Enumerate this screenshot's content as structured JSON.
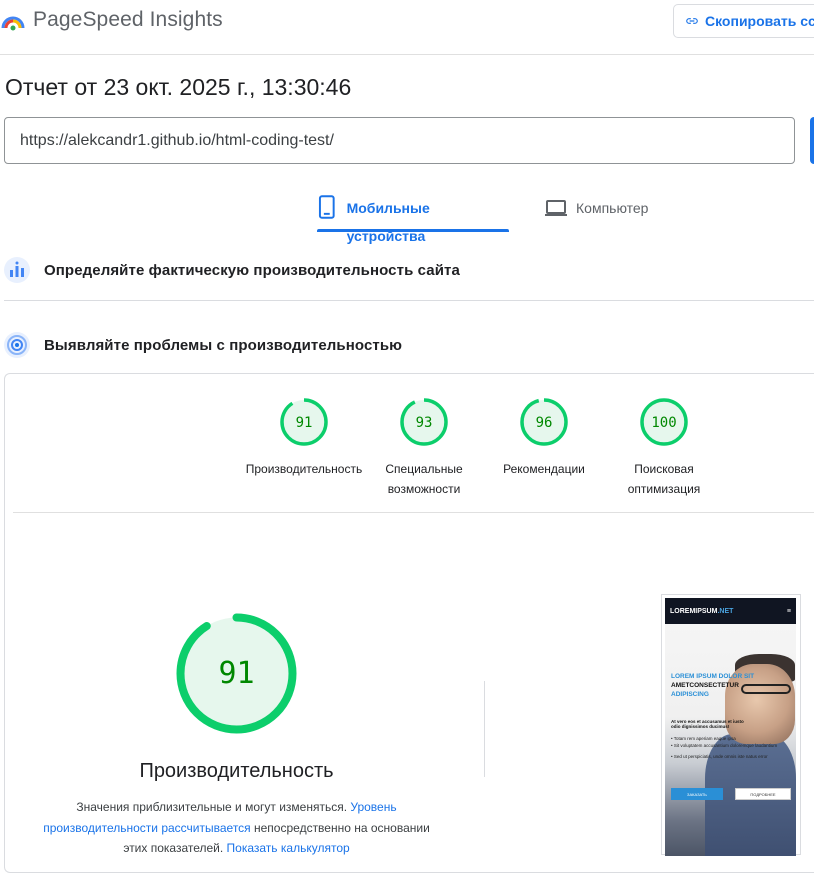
{
  "app": {
    "title": "PageSpeed Insights",
    "copy_label": "Скопировать сс"
  },
  "report": {
    "title": "Отчет от 23 окт. 2025 г., 13:30:46"
  },
  "url_field": {
    "value": "https://alekcandr1.github.io/html-coding-test/"
  },
  "tabs": [
    {
      "label": "Мобильные устройства",
      "active": true,
      "icon": "phone-icon"
    },
    {
      "label": "Компьютер",
      "active": false,
      "icon": "laptop-icon"
    }
  ],
  "sections": [
    {
      "label": "Определяйте фактическую производительность сайта",
      "icon": "field-data-icon"
    },
    {
      "label": "Выявляйте проблемы с производительностью",
      "icon": "diagnose-icon"
    }
  ],
  "scores": [
    {
      "value": "91",
      "score": 91,
      "label_line1": "Производительность",
      "label_line2": ""
    },
    {
      "value": "93",
      "score": 93,
      "label_line1": "Специальные",
      "label_line2": "возможности"
    },
    {
      "value": "96",
      "score": 96,
      "label_line1": "Рекомендации",
      "label_line2": ""
    },
    {
      "value": "100",
      "score": 100,
      "label_line1": "Поисковая",
      "label_line2": "оптимизация"
    }
  ],
  "performance": {
    "score": "91",
    "score_value": 91,
    "title": "Производительность",
    "desc_prefix": "Значения приблизительные и могут изменяться. ",
    "desc_link1": "Уровень производительности рассчитывается",
    "desc_middle": " непосредственно на основании этих показателей. ",
    "desc_link2": "Показать калькулятор"
  },
  "screenshot": {
    "brand": "LOREMIPSUM",
    "brand_suffix": ".NET",
    "menu_icon": "hamburger-icon",
    "line1": "LOREM IPSUM DOLOR SIT",
    "line2": "AMETCONSECTETUR",
    "line3": "ADIPISCING",
    "para": "At vero eos et accusamus et iusto odio dignissimos ducimus!",
    "bullet1": "• Totam rem aperiam eaque ipsa",
    "bullet2": "• Sit voluptatem accusantium doloremque laudantium",
    "bullet3": "• Sed ut perspiciatis, unde omnis iste natus error",
    "btn1": "ЗАКАЗАТЬ",
    "btn2": "ПОДРОБНЕЕ"
  },
  "colors": {
    "accent": "#1a73e8",
    "pass_green": "#0cce6b",
    "pass_fill": "#e6f7ed",
    "pass_text": "#008800"
  }
}
